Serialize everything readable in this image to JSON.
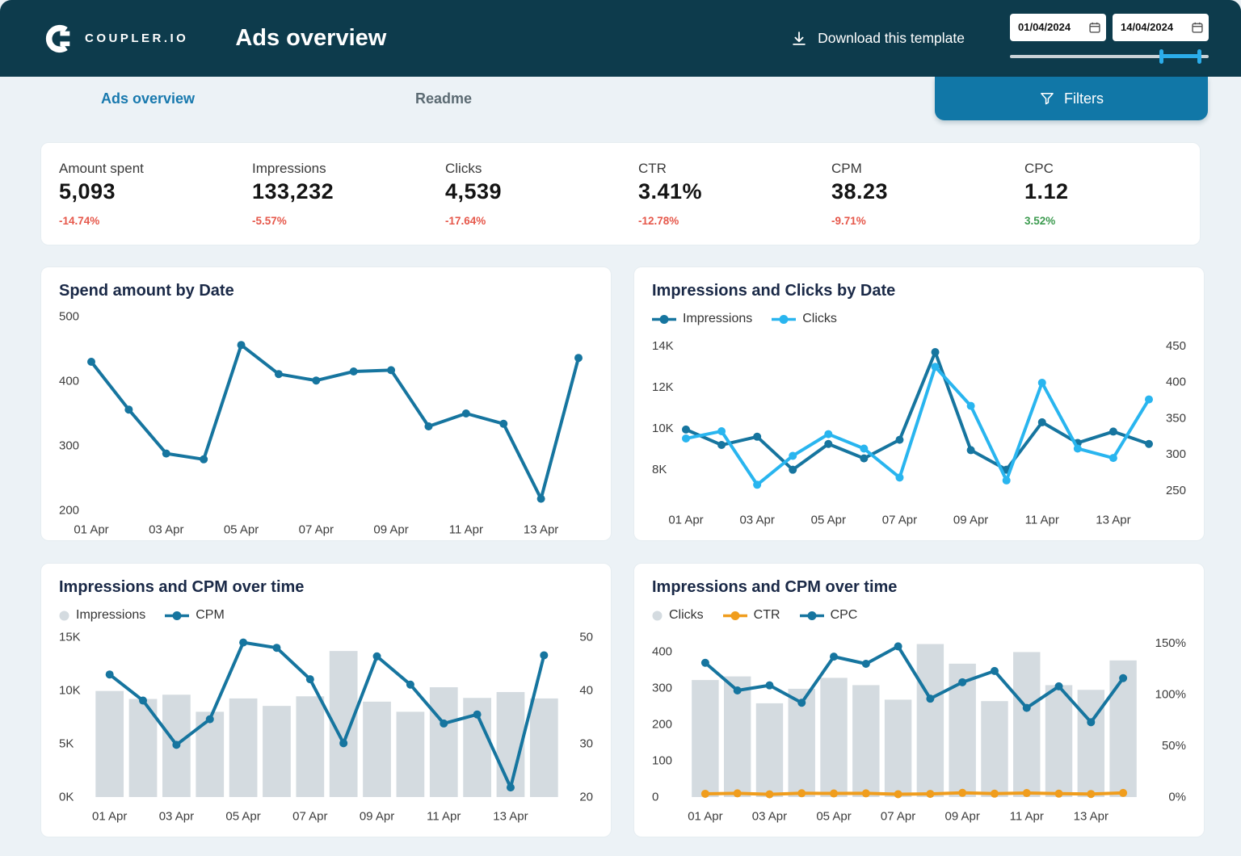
{
  "header": {
    "brand": "COUPLER.IO",
    "title": "Ads overview",
    "download_label": "Download this template",
    "date_from": "01/04/2024",
    "date_to": "14/04/2024"
  },
  "tabs": [
    {
      "label": "Ads overview",
      "active": true
    },
    {
      "label": "Readme",
      "active": false
    }
  ],
  "filters_label": "Filters",
  "kpis": [
    {
      "label": "Amount spent",
      "value": "5,093",
      "delta": "-14.74%"
    },
    {
      "label": "Impressions",
      "value": "133,232",
      "delta": "-5.57%"
    },
    {
      "label": "Clicks",
      "value": "4,539",
      "delta": "-17.64%"
    },
    {
      "label": "CTR",
      "value": "3.41%",
      "delta": "-12.78%"
    },
    {
      "label": "CPM",
      "value": "38.23",
      "delta": "-9.71%"
    },
    {
      "label": "CPC",
      "value": "1.12",
      "delta": "3.52%"
    }
  ],
  "colors": {
    "negative": "#e6584b",
    "positive": "#3d9b50",
    "accent": "#1177a7",
    "header_bg": "#0d3b4c",
    "dark_blue": "#16759f",
    "light_blue": "#29b5ef",
    "orange": "#f09d1d",
    "bar_gray": "#d4dbe0"
  },
  "chart_data": [
    {
      "type": "line",
      "title": "Spend amount by Date",
      "categories": [
        "01 Apr",
        "02 Apr",
        "03 Apr",
        "04 Apr",
        "05 Apr",
        "06 Apr",
        "07 Apr",
        "08 Apr",
        "09 Apr",
        "10 Apr",
        "11 Apr",
        "12 Apr",
        "13 Apr",
        "14 Apr"
      ],
      "x_tick_indices": [
        0,
        2,
        4,
        6,
        8,
        10,
        12
      ],
      "x_mode": "edge",
      "grid": false,
      "legend": [],
      "left_axis": {
        "min": 200,
        "max": 500,
        "ticks": [
          {
            "value": 500,
            "label": "500"
          },
          {
            "value": 400,
            "label": "400"
          },
          {
            "value": 300,
            "label": "300"
          },
          {
            "value": 200,
            "label": "200"
          }
        ]
      },
      "right_axis": null,
      "series": [
        {
          "name": "Spend amount",
          "type": "line",
          "axis": "left",
          "color": "#16759f",
          "values": [
            430,
            356,
            288,
            279,
            456,
            411,
            401,
            415,
            417,
            330,
            350,
            334,
            218,
            436
          ]
        }
      ]
    },
    {
      "type": "line",
      "title": "Impressions and Clicks by Date",
      "categories": [
        "01 Apr",
        "02 Apr",
        "03 Apr",
        "04 Apr",
        "05 Apr",
        "06 Apr",
        "07 Apr",
        "08 Apr",
        "09 Apr",
        "10 Apr",
        "11 Apr",
        "12 Apr",
        "13 Apr",
        "14 Apr"
      ],
      "x_tick_indices": [
        0,
        2,
        4,
        6,
        8,
        10,
        12
      ],
      "x_mode": "edge",
      "grid": false,
      "legend": [
        {
          "label": "Impressions",
          "color": "#16759f",
          "style": "line"
        },
        {
          "label": "Clicks",
          "color": "#29b5ef",
          "style": "line"
        }
      ],
      "left_axis": {
        "min": 6500,
        "max": 14250,
        "ticks": [
          {
            "value": 14000,
            "label": "14K"
          },
          {
            "value": 12000,
            "label": "12K"
          },
          {
            "value": 10000,
            "label": "10K"
          },
          {
            "value": 8000,
            "label": "8K"
          }
        ]
      },
      "right_axis": {
        "min": 236,
        "max": 457,
        "ticks": [
          {
            "value": 450,
            "label": "450"
          },
          {
            "value": 400,
            "label": "400"
          },
          {
            "value": 350,
            "label": "350"
          },
          {
            "value": 300,
            "label": "300"
          },
          {
            "value": 250,
            "label": "250"
          }
        ]
      },
      "series": [
        {
          "name": "Impressions",
          "type": "line",
          "axis": "left",
          "color": "#16759f",
          "values": [
            9950,
            9200,
            9600,
            8000,
            9250,
            8550,
            9450,
            13700,
            8950,
            8000,
            10300,
            9300,
            9850,
            9250
          ]
        },
        {
          "name": "Clicks",
          "type": "line",
          "axis": "right",
          "color": "#29b5ef",
          "values": [
            322,
            332,
            258,
            298,
            328,
            308,
            268,
            421,
            367,
            264,
            399,
            308,
            295,
            376
          ]
        }
      ]
    },
    {
      "type": "combo",
      "title": "Impressions and CPM over time",
      "categories": [
        "01 Apr",
        "02 Apr",
        "03 Apr",
        "04 Apr",
        "05 Apr",
        "06 Apr",
        "07 Apr",
        "08 Apr",
        "09 Apr",
        "10 Apr",
        "11 Apr",
        "12 Apr",
        "13 Apr",
        "14 Apr"
      ],
      "x_tick_indices": [
        0,
        2,
        4,
        6,
        8,
        10,
        12
      ],
      "x_mode": "center",
      "grid": false,
      "legend": [
        {
          "label": "Impressions",
          "color": "#d4dbe0",
          "style": "dot"
        },
        {
          "label": "CPM",
          "color": "#16759f",
          "style": "line"
        }
      ],
      "left_axis": {
        "min": 0,
        "max": 15000,
        "ticks": [
          {
            "value": 15000,
            "label": "15K"
          },
          {
            "value": 10000,
            "label": "10K"
          },
          {
            "value": 5000,
            "label": "5K"
          },
          {
            "value": 0,
            "label": "0K"
          }
        ]
      },
      "right_axis": {
        "min": 20,
        "max": 50,
        "ticks": [
          {
            "value": 50,
            "label": "50"
          },
          {
            "value": 40,
            "label": "40"
          },
          {
            "value": 30,
            "label": "30"
          },
          {
            "value": 20,
            "label": "20"
          }
        ]
      },
      "series": [
        {
          "name": "Impressions",
          "type": "bar",
          "axis": "left",
          "color": "#d4dbe0",
          "values": [
            9950,
            9200,
            9600,
            8000,
            9250,
            8550,
            9450,
            13700,
            8950,
            8000,
            10300,
            9300,
            9850,
            9250
          ]
        },
        {
          "name": "CPM",
          "type": "line",
          "axis": "right",
          "color": "#16759f",
          "values": [
            43,
            38.1,
            29.8,
            34.6,
            49,
            48,
            42.1,
            30.1,
            46.4,
            41.1,
            33.8,
            35.5,
            21.8,
            46.6
          ]
        }
      ]
    },
    {
      "type": "combo",
      "title": "Impressions and CPM over time",
      "categories": [
        "01 Apr",
        "02 Apr",
        "03 Apr",
        "04 Apr",
        "05 Apr",
        "06 Apr",
        "07 Apr",
        "08 Apr",
        "09 Apr",
        "10 Apr",
        "11 Apr",
        "12 Apr",
        "13 Apr",
        "14 Apr"
      ],
      "x_tick_indices": [
        0,
        2,
        4,
        6,
        8,
        10,
        12
      ],
      "x_mode": "center",
      "grid": false,
      "legend": [
        {
          "label": "Clicks",
          "color": "#d4dbe0",
          "style": "dot"
        },
        {
          "label": "CTR",
          "color": "#f09d1d",
          "style": "line"
        },
        {
          "label": "CPC",
          "color": "#16759f",
          "style": "line"
        }
      ],
      "left_axis": {
        "min": 0,
        "max": 440,
        "ticks": [
          {
            "value": 400,
            "label": "400"
          },
          {
            "value": 300,
            "label": "300"
          },
          {
            "value": 200,
            "label": "200"
          },
          {
            "value": 100,
            "label": "100"
          },
          {
            "value": 0,
            "label": "0"
          }
        ]
      },
      "right_axis": {
        "min": 0,
        "max": 156,
        "ticks": [
          {
            "value": 150,
            "label": "150%"
          },
          {
            "value": 100,
            "label": "100%"
          },
          {
            "value": 50,
            "label": "50%"
          },
          {
            "value": 0,
            "label": "0%"
          }
        ]
      },
      "series": [
        {
          "name": "Clicks",
          "type": "bar",
          "axis": "left",
          "color": "#d4dbe0",
          "values": [
            322,
            332,
            258,
            298,
            328,
            308,
            268,
            421,
            367,
            264,
            399,
            308,
            295,
            376
          ]
        },
        {
          "name": "CTR",
          "type": "line",
          "axis": "right",
          "color": "#f09d1d",
          "values": [
            3.2,
            3.6,
            2.7,
            3.7,
            3.5,
            3.6,
            2.8,
            3.1,
            4.1,
            3.3,
            3.9,
            3.3,
            3,
            4
          ]
        },
        {
          "name": "CPC",
          "type": "line",
          "axis": "right",
          "color": "#16759f",
          "values": [
            131,
            104,
            109,
            92,
            137,
            130,
            147,
            96,
            112,
            123,
            87,
            108,
            73,
            116
          ]
        }
      ]
    }
  ]
}
